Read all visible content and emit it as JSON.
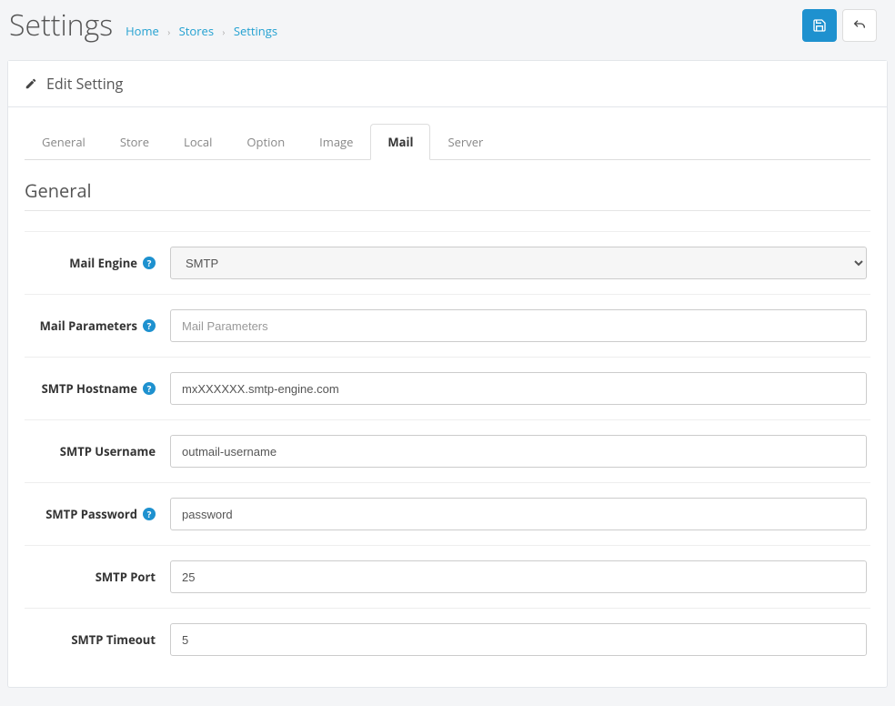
{
  "header": {
    "title": "Settings",
    "breadcrumb": {
      "home": "Home",
      "stores": "Stores",
      "settings": "Settings"
    }
  },
  "panel": {
    "title": "Edit Setting"
  },
  "tabs": {
    "general": "General",
    "store": "Store",
    "local": "Local",
    "option": "Option",
    "image": "Image",
    "mail": "Mail",
    "server": "Server"
  },
  "section": {
    "legend": "General"
  },
  "form": {
    "mail_engine": {
      "label": "Mail Engine",
      "value": "SMTP",
      "help": true
    },
    "mail_parameters": {
      "label": "Mail Parameters",
      "placeholder": "Mail Parameters",
      "value": "",
      "help": true
    },
    "smtp_hostname": {
      "label": "SMTP Hostname",
      "value": "mxXXXXXX.smtp-engine.com",
      "help": true
    },
    "smtp_username": {
      "label": "SMTP Username",
      "value": "outmail-username",
      "help": false
    },
    "smtp_password": {
      "label": "SMTP Password",
      "value": "password",
      "help": true
    },
    "smtp_port": {
      "label": "SMTP Port",
      "value": "25",
      "help": false
    },
    "smtp_timeout": {
      "label": "SMTP Timeout",
      "value": "5",
      "help": false
    }
  }
}
